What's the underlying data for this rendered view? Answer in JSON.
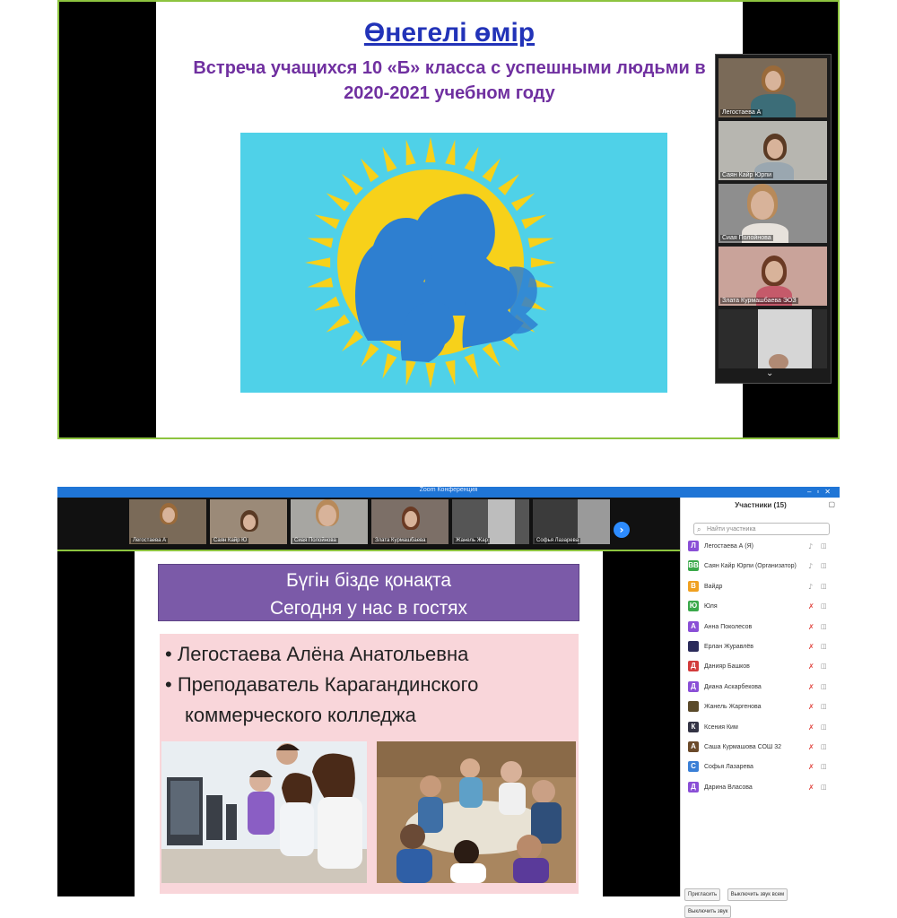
{
  "top": {
    "slide": {
      "title": "Өнегелі өмір",
      "subtitle": "Встреча учащихся 10 «Б» класса с успешными людьми в 2020-2021 учебном году"
    },
    "video_tiles": [
      {
        "name": "Легостаева А",
        "bg": "#7a6a58"
      },
      {
        "name": "Саян Кайр Юрпи",
        "bg": "#b7b6b0"
      },
      {
        "name": "Сиая Полойнова",
        "bg": "#8e8e8e"
      },
      {
        "name": "Злата Курмашбаева ЭОЗ",
        "bg": "#c9a39a"
      },
      {
        "name": "",
        "bg": "#2c2c2c"
      }
    ],
    "scroll_icon": "chevron-down-icon"
  },
  "bottom": {
    "window_title": "Zoom Конференция",
    "thumbnails": [
      {
        "name": "Легостаева А",
        "bg": "#7a6a58"
      },
      {
        "name": "Саян Кайр Ю",
        "bg": "#9b8a78"
      },
      {
        "name": "Сиая Полойнова",
        "bg": "#a7a6a2"
      },
      {
        "name": "Злата Курмашбаева",
        "bg": "#7c6f67"
      },
      {
        "name": "Жанель Жар",
        "bg": "#555"
      },
      {
        "name": "Софья Лазарева",
        "bg": "#3b3b3b"
      }
    ],
    "slide": {
      "banner_line1": "Бүгін бізде қонақта",
      "banner_line2": "Сегодня у нас в гостях",
      "bullet1": "• Легостаева Алёна Анатольевна",
      "bullet2": "• Преподаватель Карагандинского коммерческого колледжа"
    },
    "participants": {
      "header": "Участники (15)",
      "search_placeholder": "Найти участника",
      "list": [
        {
          "initial": "Л",
          "color": "#8a4fd6",
          "name": "Легостаева А (Я)",
          "mic": "on"
        },
        {
          "initial": "ВВ",
          "color": "#3aa84a",
          "name": "Саян Кайр Юрпи (Организатор)",
          "mic": "on"
        },
        {
          "initial": "В",
          "color": "#f0a020",
          "name": "Вайдр",
          "mic": "on"
        },
        {
          "initial": "Ю",
          "color": "#3aa84a",
          "name": "Юля",
          "mic": "off"
        },
        {
          "initial": "А",
          "color": "#8a4fd6",
          "name": "Анна Поколесов",
          "mic": "off"
        },
        {
          "initial": "",
          "color": "#2a2a5a",
          "name": "Ерлан Журавлёв",
          "mic": "off"
        },
        {
          "initial": "Д",
          "color": "#d23b3b",
          "name": "Данияр Башков",
          "mic": "off"
        },
        {
          "initial": "Д",
          "color": "#8a4fd6",
          "name": "Диана Аскарбекова",
          "mic": "off"
        },
        {
          "initial": "",
          "color": "#5a4a2a",
          "name": "Жанель Жаргенова",
          "mic": "off"
        },
        {
          "initial": "К",
          "color": "#333344",
          "name": "Ксения Ким",
          "mic": "off"
        },
        {
          "initial": "А",
          "color": "#6b4a2a",
          "name": "Саша Курмашова СОШ 32",
          "mic": "off"
        },
        {
          "initial": "С",
          "color": "#3a7fd6",
          "name": "Софья Лазарева",
          "mic": "off"
        },
        {
          "initial": "Д",
          "color": "#8a4fd6",
          "name": "Дарина Власова",
          "mic": "off"
        }
      ],
      "footer": [
        "Пригласить",
        "Выключить звук всем",
        "Выключить звук"
      ]
    }
  }
}
